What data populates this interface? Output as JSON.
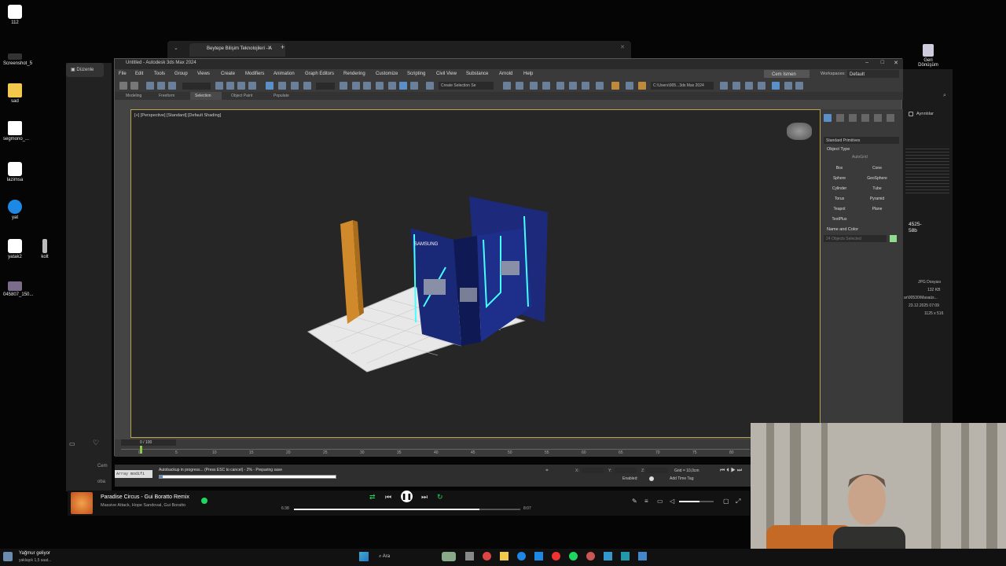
{
  "desktop": {
    "icons": [
      {
        "label": "112"
      },
      {
        "label": "Screenshot_5"
      },
      {
        "label": "sad"
      },
      {
        "label": "segmono_..."
      },
      {
        "label": "lazimsa"
      },
      {
        "label": "yat"
      },
      {
        "label": "yatak2"
      },
      {
        "label": "kolt"
      },
      {
        "label": "045807_150..."
      }
    ],
    "recycle_label": "Geri Dönüşüm"
  },
  "browser": {
    "tab_title": "Beytepe Bilişim Teknolojileri - A",
    "new_tab": "+"
  },
  "left_panel": {
    "label": "Düzenle",
    "sub1": "Cem",
    "sub2": "oba"
  },
  "max": {
    "title": "Untitled - Autodesk 3ds Max 2024",
    "user": "Cem Ismen",
    "workspace_label": "Workspaces:",
    "workspace_value": "Default",
    "menus": [
      "File",
      "Edit",
      "Tools",
      "Group",
      "Views",
      "Create",
      "Modifiers",
      "Animation",
      "Graph Editors",
      "Rendering",
      "Customize",
      "Scripting",
      "Civil View",
      "Substance",
      "Arnold",
      "Help"
    ],
    "selection_set": "Create Selection Se",
    "path": "C:\\Users\\905...3ds Max 2024",
    "ribbon_tabs": [
      "Modeling",
      "Freeform",
      "Selection",
      "Object Paint",
      "Populate"
    ],
    "viewport_label": "[+] [Perspective] [Standard] [Default Shading]",
    "brand_text": "SAMSUNG",
    "cmd": {
      "category": "Standard Primitives",
      "object_type_header": "Object Type",
      "autogrid": "AutoGrid",
      "buttons": [
        "Box",
        "Cone",
        "Sphere",
        "GeoSphere",
        "Cylinder",
        "Tube",
        "Torus",
        "Pyramid",
        "Teapot",
        "Plane",
        "TextPlus"
      ],
      "name_color_header": "Name and Color",
      "name_placeholder": "24 Objects Selected"
    },
    "timeline": {
      "frame": "0 / 100",
      "ticks": [
        "0",
        "5",
        "10",
        "15",
        "20",
        "25",
        "30",
        "35",
        "40",
        "45",
        "50",
        "55",
        "60",
        "65",
        "70",
        "75",
        "80"
      ]
    },
    "status": {
      "script": "Array modifi",
      "message": "Autobackup in progress... (Press ESC to cancel) - 2% - Preparing save",
      "x_label": "X:",
      "y_label": "Y:",
      "z_label": "Z:",
      "grid": "Grid = 10,0cm",
      "enabled": "Enabled:",
      "add_time_tag": "Add Time Tag"
    }
  },
  "explorer": {
    "details": "Ayrıntılar",
    "size_text": "4525-58b",
    "file_type": "JPG Dosyası",
    "file_size": "132 KB",
    "path": "ar\\90530\\Masaüs...",
    "date": "23.12.2025 07:09",
    "dims": "1125 x 516"
  },
  "player": {
    "song": "Paradise Circus - Gui Boratto Remix",
    "artists": "Massive Attack, Hope Sandoval, Gui Boratto",
    "elapsed": "6:38",
    "total": "8:07",
    "progress": 0.82,
    "volume": 0.6
  },
  "taskbar": {
    "weather_line1": "Yağmur geliyor",
    "weather_line2": "yaklaşık 1,5 saat...",
    "search": "Ara"
  }
}
